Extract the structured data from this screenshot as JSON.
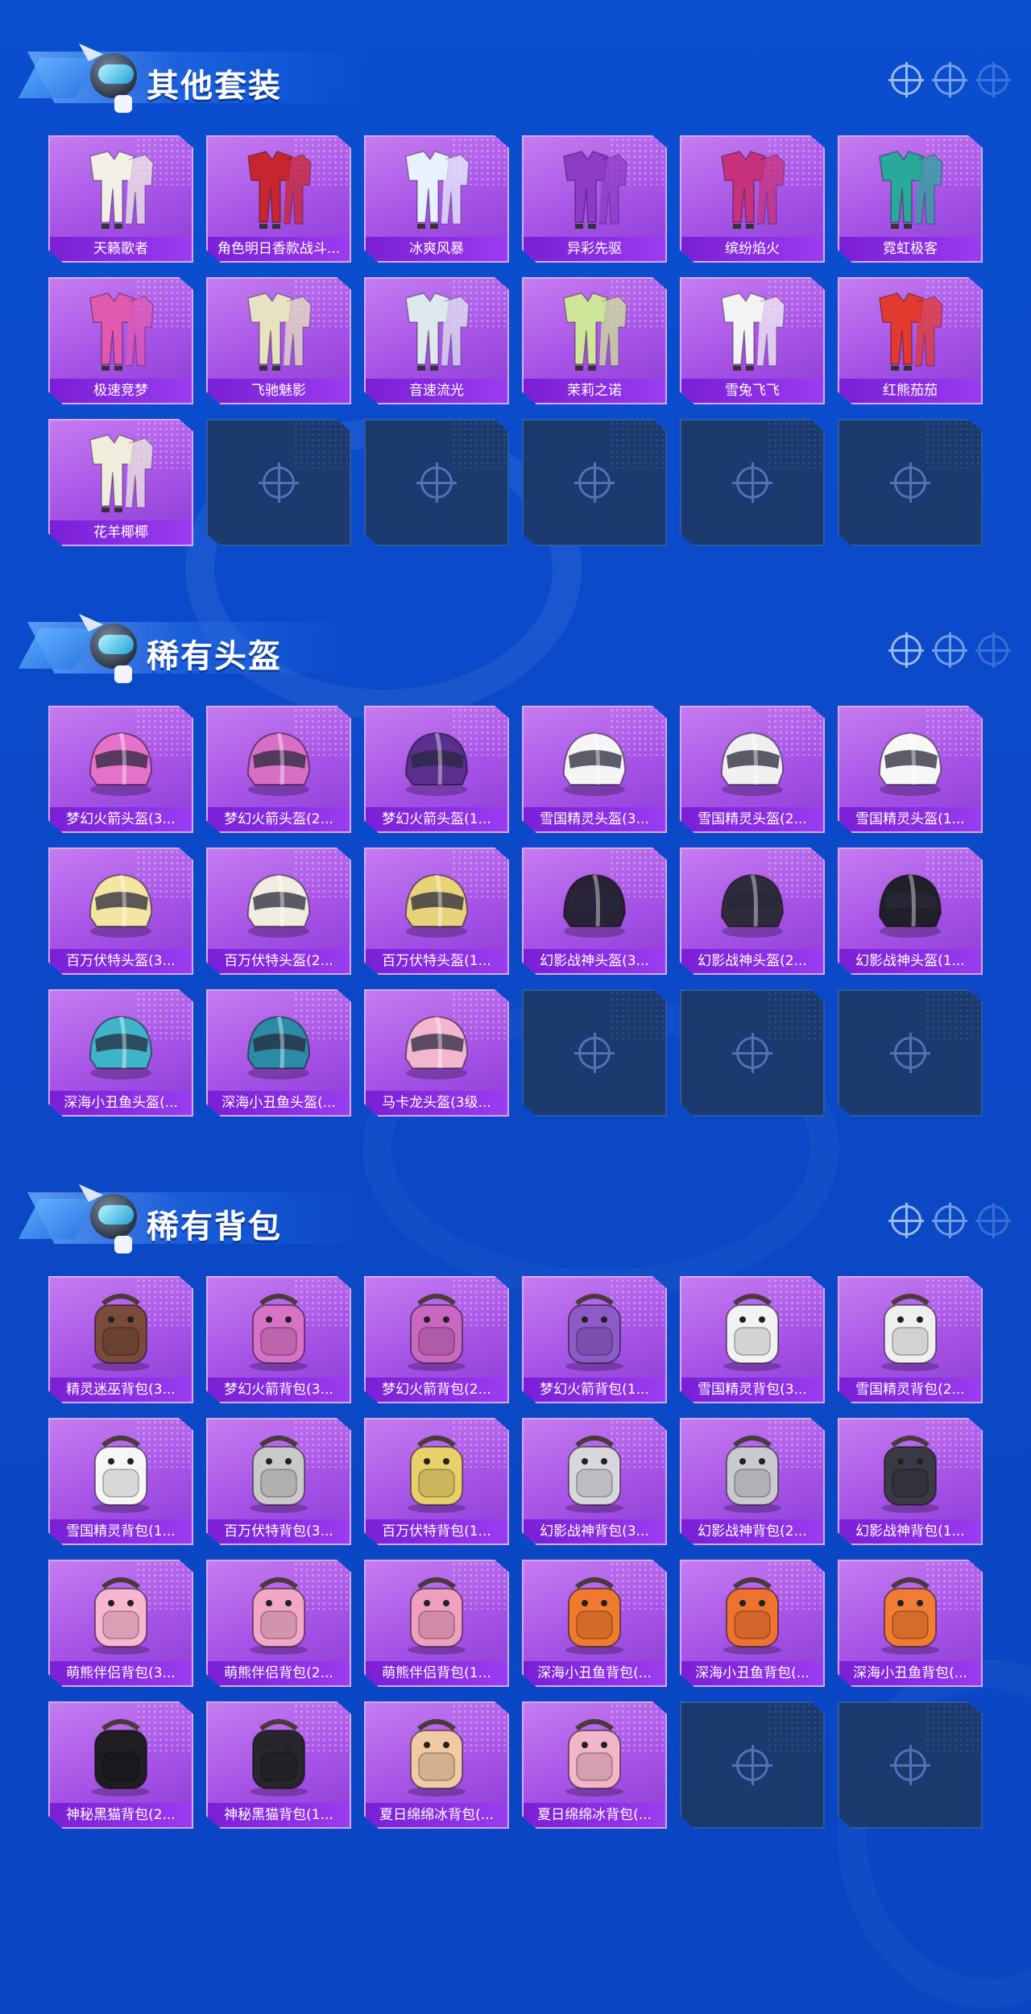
{
  "sections": [
    {
      "title": "其他套装",
      "items": [
        {
          "label": "天籁歌者",
          "icon": "outfit-icon",
          "color": "#f2efe6"
        },
        {
          "label": "角色明日香款战斗...",
          "icon": "outfit-icon",
          "color": "#c8262e"
        },
        {
          "label": "冰爽风暴",
          "icon": "outfit-icon",
          "color": "#e8f2ff"
        },
        {
          "label": "异彩先驱",
          "icon": "outfit-icon",
          "color": "#8d3cc8"
        },
        {
          "label": "缤纷焰火",
          "icon": "outfit-icon",
          "color": "#c6327c"
        },
        {
          "label": "霓虹极客",
          "icon": "outfit-icon",
          "color": "#2aa89a"
        },
        {
          "label": "极速竞梦",
          "icon": "outfit-icon",
          "color": "#e25ab0"
        },
        {
          "label": "飞驰魅影",
          "icon": "outfit-icon",
          "color": "#e7e3c2"
        },
        {
          "label": "音速流光",
          "icon": "outfit-icon",
          "color": "#dfe7ee"
        },
        {
          "label": "茉莉之诺",
          "icon": "outfit-icon",
          "color": "#cfe59a"
        },
        {
          "label": "雪兔飞飞",
          "icon": "outfit-icon",
          "color": "#f3f3f3"
        },
        {
          "label": "红熊茄茄",
          "icon": "outfit-icon",
          "color": "#e23a2e"
        },
        {
          "label": "花羊椰椰",
          "icon": "outfit-icon",
          "color": "#efeedd"
        }
      ]
    },
    {
      "title": "稀有头盔",
      "items": [
        {
          "label": "梦幻火箭头盔(3...",
          "icon": "helmet-icon",
          "color": "#e572c9"
        },
        {
          "label": "梦幻火箭头盔(2...",
          "icon": "helmet-icon",
          "color": "#d86ec6"
        },
        {
          "label": "梦幻火箭头盔(1...",
          "icon": "helmet-icon",
          "color": "#5a2f8e"
        },
        {
          "label": "雪国精灵头盔(3...",
          "icon": "helmet-icon",
          "color": "#f5f5f5"
        },
        {
          "label": "雪国精灵头盔(2...",
          "icon": "helmet-icon",
          "color": "#f0f0f0"
        },
        {
          "label": "雪国精灵头盔(1...",
          "icon": "helmet-icon",
          "color": "#f7f7f7"
        },
        {
          "label": "百万伏特头盔(3...",
          "icon": "helmet-icon",
          "color": "#f4e6a0"
        },
        {
          "label": "百万伏特头盔(2...",
          "icon": "helmet-icon",
          "color": "#f0ede0"
        },
        {
          "label": "百万伏特头盔(1...",
          "icon": "helmet-icon",
          "color": "#e8d37a"
        },
        {
          "label": "幻影战神头盔(3...",
          "icon": "helmet-icon",
          "color": "#2a2236"
        },
        {
          "label": "幻影战神头盔(2...",
          "icon": "helmet-icon",
          "color": "#2f2b3a"
        },
        {
          "label": "幻影战神头盔(1...",
          "icon": "helmet-icon",
          "color": "#202028"
        },
        {
          "label": "深海小丑鱼头盔(...",
          "icon": "helmet-icon",
          "color": "#3fb3c9"
        },
        {
          "label": "深海小丑鱼头盔(...",
          "icon": "helmet-icon",
          "color": "#2b8aa5"
        },
        {
          "label": "马卡龙头盔(3级...",
          "icon": "helmet-icon",
          "color": "#f4b6cf"
        }
      ]
    },
    {
      "title": "稀有背包",
      "items": [
        {
          "label": "精灵迷巫背包(3...",
          "icon": "backpack-icon",
          "color": "#7a4a3a"
        },
        {
          "label": "梦幻火箭背包(3...",
          "icon": "backpack-icon",
          "color": "#d772c6"
        },
        {
          "label": "梦幻火箭背包(2...",
          "icon": "backpack-icon",
          "color": "#c968c0"
        },
        {
          "label": "梦幻火箭背包(1...",
          "icon": "backpack-icon",
          "color": "#8c5bc7"
        },
        {
          "label": "雪国精灵背包(3...",
          "icon": "backpack-icon",
          "color": "#f2f2f2"
        },
        {
          "label": "雪国精灵背包(2...",
          "icon": "backpack-icon",
          "color": "#efefef"
        },
        {
          "label": "雪国精灵背包(1...",
          "icon": "backpack-icon",
          "color": "#f6f6f6"
        },
        {
          "label": "百万伏特背包(3...",
          "icon": "backpack-icon",
          "color": "#c9c9c9"
        },
        {
          "label": "百万伏特背包(1...",
          "icon": "backpack-icon",
          "color": "#e8d06a"
        },
        {
          "label": "幻影战神背包(3...",
          "icon": "backpack-icon",
          "color": "#d8d8dc"
        },
        {
          "label": "幻影战神背包(2...",
          "icon": "backpack-icon",
          "color": "#c9c9cf"
        },
        {
          "label": "幻影战神背包(1...",
          "icon": "backpack-icon",
          "color": "#3a3a44"
        },
        {
          "label": "萌熊伴侣背包(3...",
          "icon": "backpack-icon",
          "color": "#f7b7cf"
        },
        {
          "label": "萌熊伴侣背包(2...",
          "icon": "backpack-icon",
          "color": "#f2a8c4"
        },
        {
          "label": "萌熊伴侣背包(1...",
          "icon": "backpack-icon",
          "color": "#f09fbe"
        },
        {
          "label": "深海小丑鱼背包(...",
          "icon": "backpack-icon",
          "color": "#f07a2e"
        },
        {
          "label": "深海小丑鱼背包(...",
          "icon": "backpack-icon",
          "color": "#ee7330"
        },
        {
          "label": "深海小丑鱼背包(...",
          "icon": "backpack-icon",
          "color": "#f27c33"
        },
        {
          "label": "神秘黑猫背包(2...",
          "icon": "backpack-icon",
          "color": "#1d1d22"
        },
        {
          "label": "神秘黑猫背包(1...",
          "icon": "backpack-icon",
          "color": "#26262c"
        },
        {
          "label": "夏日绵绵冰背包(...",
          "icon": "backpack-icon",
          "color": "#f1c9a2"
        },
        {
          "label": "夏日绵绵冰背包(...",
          "icon": "backpack-icon",
          "color": "#f3b5c8"
        }
      ]
    }
  ]
}
